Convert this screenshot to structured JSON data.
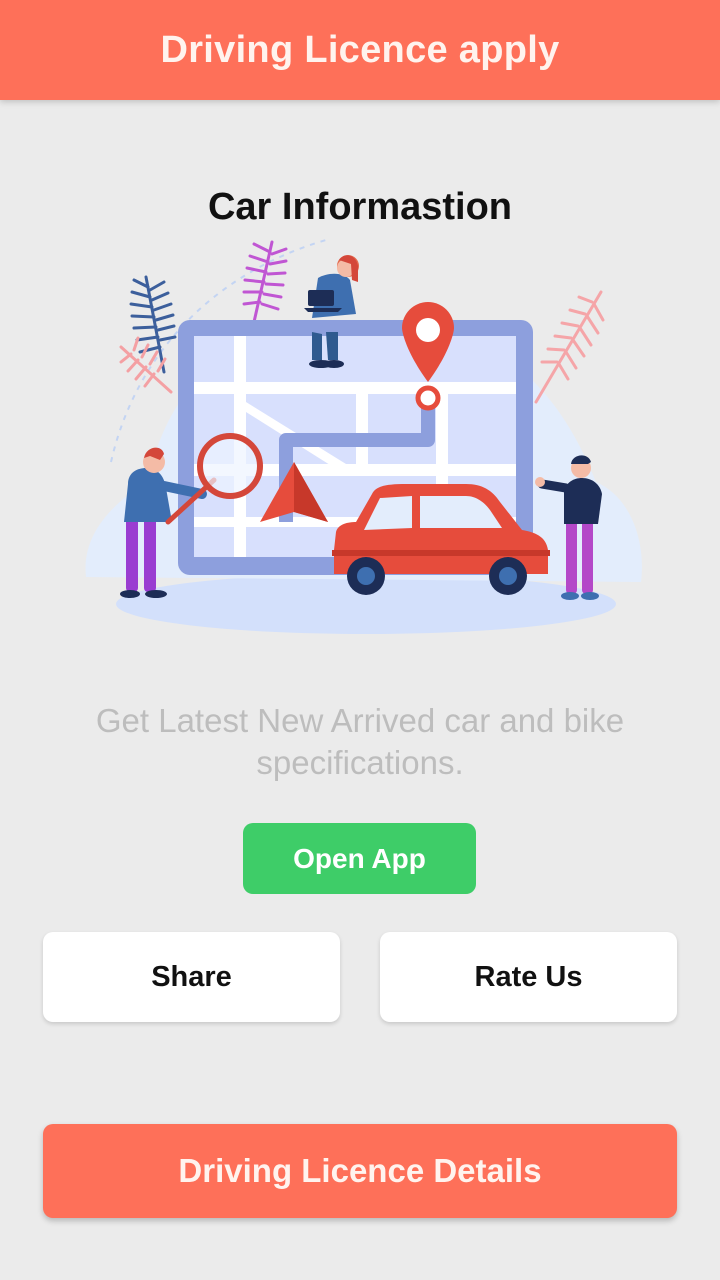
{
  "appbar": {
    "title": "Driving Licence apply"
  },
  "main": {
    "section_title": "Car Informastion",
    "subtitle": "Get Latest New Arrived car and bike specifications.",
    "open_app_label": "Open App",
    "share_label": "Share",
    "rate_label": "Rate Us",
    "details_label": "Driving Licence Details"
  },
  "colors": {
    "accent": "#fe7059",
    "green": "#3ecd68",
    "background": "#ebebeb"
  }
}
